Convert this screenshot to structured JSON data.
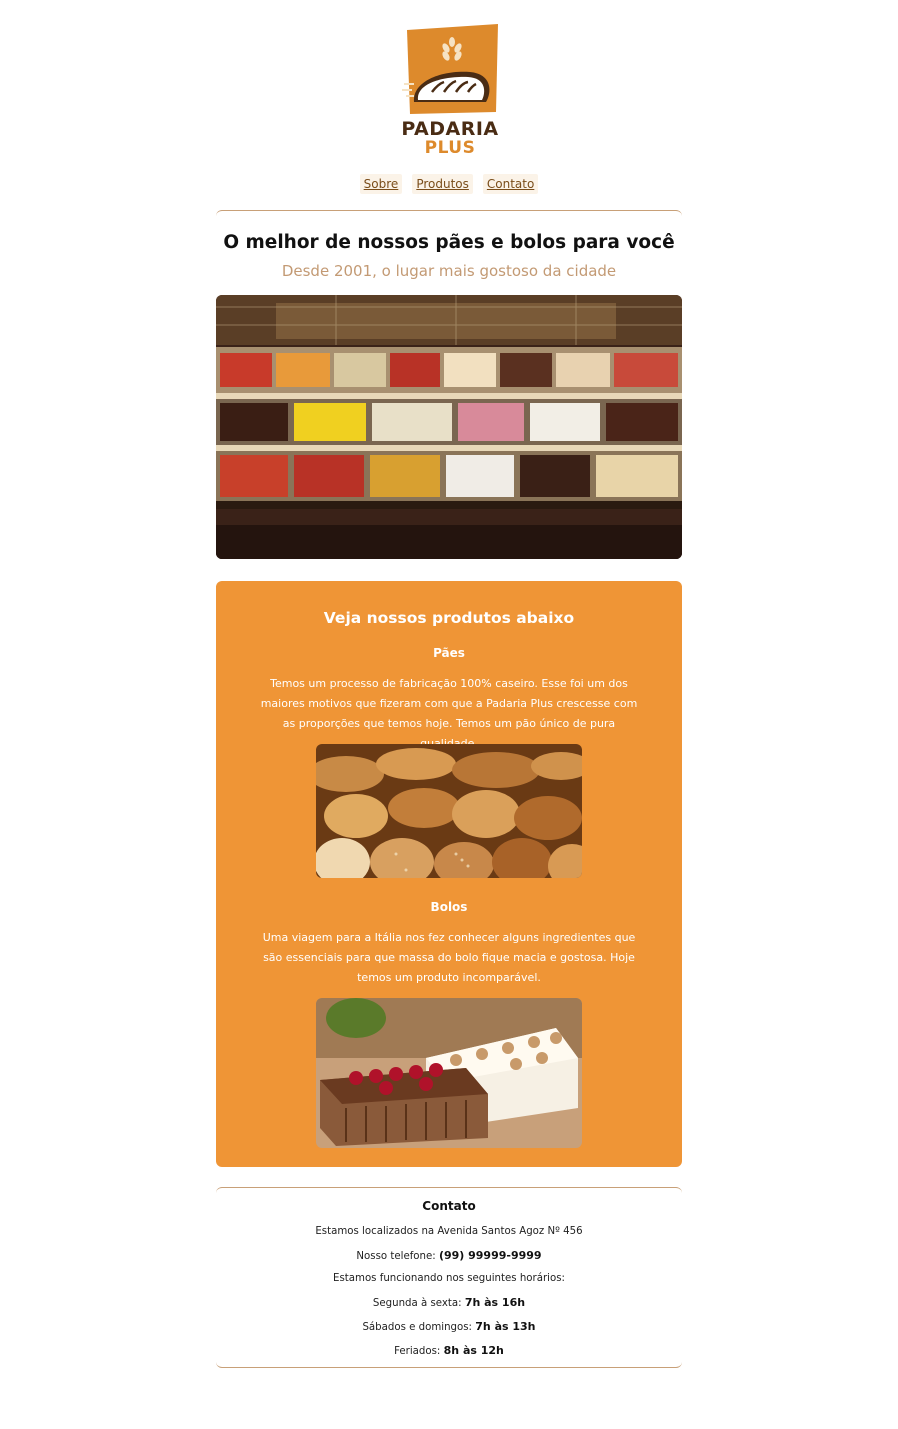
{
  "logo": {
    "line1": "PADARIA",
    "line2": "PLUS"
  },
  "nav": [
    {
      "label": "Sobre"
    },
    {
      "label": "Produtos"
    },
    {
      "label": "Contato"
    }
  ],
  "hero": {
    "title": "O melhor de nossos pães e bolos para você",
    "subtitle": "Desde 2001, o lugar mais gostoso da cidade"
  },
  "products": {
    "title": "Veja nossos produtos abaixo",
    "items": [
      {
        "heading": "Pães",
        "text": "Temos um processo de fabricação 100% caseiro. Esse foi um dos maiores motivos que fizeram com que a Padaria Plus crescesse com as proporções que temos hoje. Temos um pão único de pura qualidade."
      },
      {
        "heading": "Bolos",
        "text": "Uma viagem para a Itália nos fez conhecer alguns ingredientes que são essenciais para que massa do bolo fique macia e gostosa. Hoje temos um produto incomparável."
      }
    ]
  },
  "contact": {
    "title": "Contato",
    "address": "Estamos localizados na Avenida Santos Agoz Nº 456",
    "phone_label": "Nosso telefone:",
    "phone": "(99) 99999-9999",
    "hours_intro": "Estamos funcionando nos seguintes horários:",
    "weekdays_label": "Segunda à sexta:",
    "weekdays_hours": "7h às 16h",
    "weekend_label": "Sábados e domingos:",
    "weekend_hours": "7h às 13h",
    "holidays_label": "Feriados:",
    "holidays_hours": "8h às 12h"
  },
  "colors": {
    "accent": "#ef9536",
    "brown": "#4a2c14",
    "rule": "#c8a078",
    "subtitle": "#c39a74"
  }
}
